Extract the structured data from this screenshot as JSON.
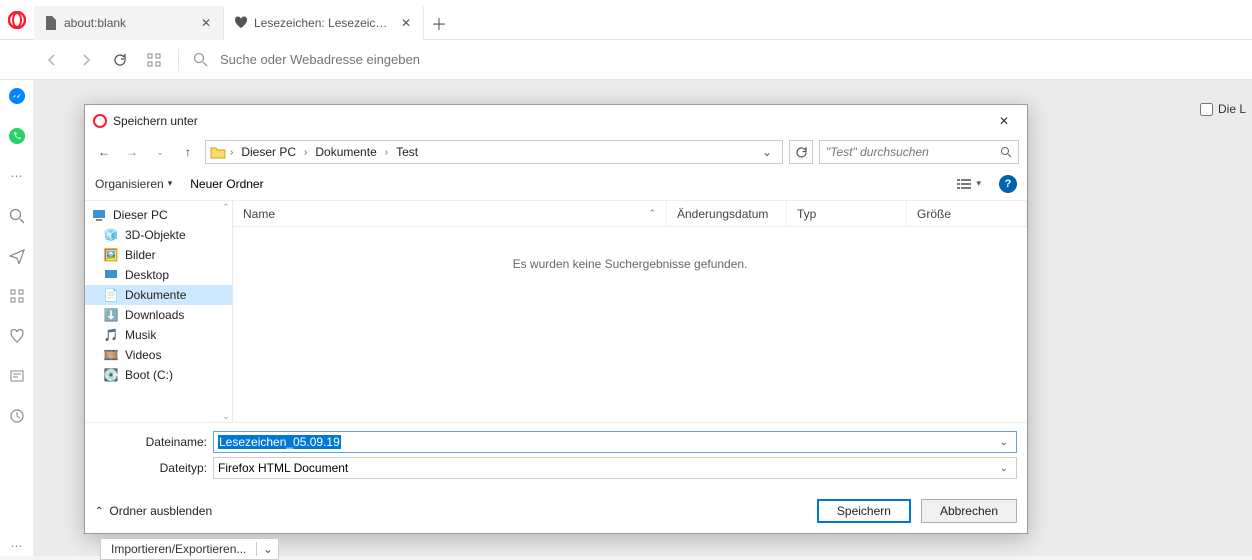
{
  "browser": {
    "tabs": [
      {
        "title": "about:blank",
        "icon": "file"
      },
      {
        "title": "Lesezeichen: Lesezeichenle",
        "icon": "heart"
      }
    ],
    "search_placeholder": "Suche oder Webadresse eingeben"
  },
  "right_checkbox_label": "Die L",
  "dialog": {
    "title": "Speichern unter",
    "breadcrumb": [
      "Dieser PC",
      "Dokumente",
      "Test"
    ],
    "search_placeholder": "\"Test\" durchsuchen",
    "toolbar": {
      "organize": "Organisieren",
      "new_folder": "Neuer Ordner"
    },
    "tree": {
      "root": "Dieser PC",
      "items": [
        {
          "label": "3D-Objekte",
          "icon": "cube"
        },
        {
          "label": "Bilder",
          "icon": "image"
        },
        {
          "label": "Desktop",
          "icon": "desktop"
        },
        {
          "label": "Dokumente",
          "icon": "doc",
          "selected": true
        },
        {
          "label": "Downloads",
          "icon": "download"
        },
        {
          "label": "Musik",
          "icon": "music"
        },
        {
          "label": "Videos",
          "icon": "video"
        },
        {
          "label": "Boot (C:)",
          "icon": "drive"
        }
      ]
    },
    "columns": {
      "name": "Name",
      "date": "Änderungsdatum",
      "type": "Typ",
      "size": "Größe"
    },
    "empty_message": "Es wurden keine Suchergebnisse gefunden.",
    "form": {
      "filename_label": "Dateiname:",
      "filename_value": "Lesezeichen_05.09.19",
      "filetype_label": "Dateityp:",
      "filetype_value": "Firefox HTML Document"
    },
    "footer": {
      "hide_folders": "Ordner ausblenden",
      "save": "Speichern",
      "cancel": "Abbrechen"
    }
  },
  "import_button": "Importieren/Exportieren..."
}
